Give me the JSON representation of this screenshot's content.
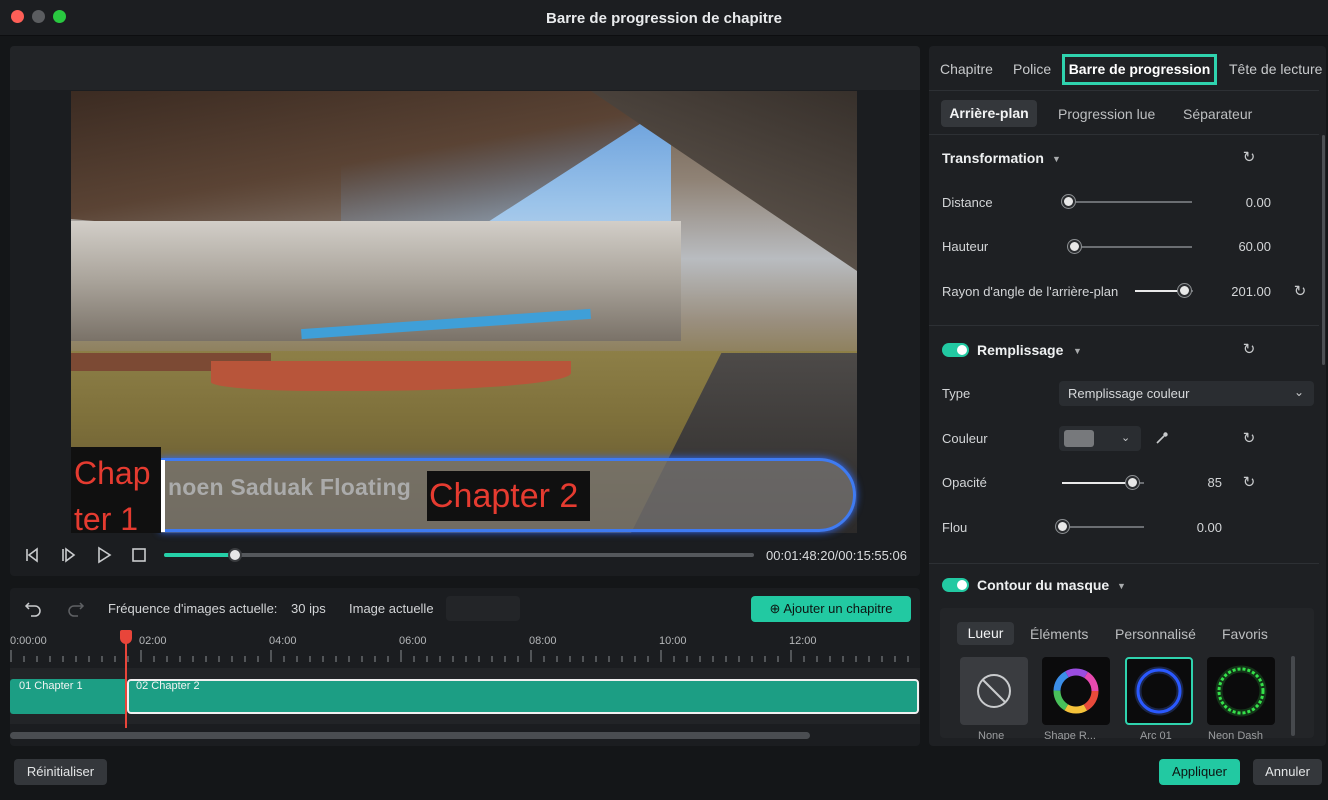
{
  "window": {
    "title": "Barre de progression de chapitre"
  },
  "preview": {
    "overlay_chapter1": "Chap ter 1",
    "overlay_floating_text": "noen Saduak Floating",
    "overlay_chapter2": "Chapter 2",
    "playback_progress": 0.12,
    "timecode": "00:01:48:20/00:15:55:06"
  },
  "timeline": {
    "frame_rate_label": "Fréquence d'images actuelle:",
    "frame_rate_value": "30 ips",
    "current_image_label": "Image actuelle",
    "add_chapter_label": "Ajouter un chapitre",
    "ruler_labels": [
      "0:00:00",
      "02:00",
      "04:00",
      "06:00",
      "08:00",
      "10:00",
      "12:00"
    ],
    "clips": [
      {
        "label": "01 Chapter 1"
      },
      {
        "label": "02 Chapter 2"
      }
    ]
  },
  "right_panel": {
    "tabs": [
      "Chapitre",
      "Police",
      "Barre de progression",
      "Tête de lecture"
    ],
    "active_tab": "Barre de progression",
    "subtabs": [
      "Arrière-plan",
      "Progression lue",
      "Séparateur"
    ],
    "active_subtab": "Arrière-plan",
    "transformation": {
      "title": "Transformation",
      "distance": {
        "label": "Distance",
        "value": "0.00",
        "level": 0.0
      },
      "height": {
        "label": "Hauteur",
        "value": "60.00",
        "level": 0.05
      },
      "corner_radius": {
        "label": "Rayon d'angle de l'arrière-plan",
        "value": "201.00",
        "level": 0.85
      }
    },
    "fill": {
      "title": "Remplissage",
      "enabled": true,
      "type_label": "Type",
      "type_value": "Remplissage couleur",
      "color_label": "Couleur",
      "color_value": "#77797c",
      "opacity": {
        "label": "Opacité",
        "value": "85",
        "level": 0.85
      },
      "blur": {
        "label": "Flou",
        "value": "0.00",
        "level": 0.0
      }
    },
    "mask_outline": {
      "title": "Contour du masque",
      "enabled": true,
      "style_tabs": [
        "Lueur",
        "Éléments",
        "Personnalisé",
        "Favoris"
      ],
      "active_style_tab": "Lueur",
      "presets": [
        {
          "label": "None",
          "icon": "none-circle-icon"
        },
        {
          "label": "Shape R...",
          "icon": "rainbow-ring-icon"
        },
        {
          "label": "Arc 01",
          "icon": "blue-ring-icon"
        },
        {
          "label": "Neon Dash",
          "icon": "green-dashed-ring-icon"
        }
      ]
    }
  },
  "footer": {
    "reset_label": "Réinitialiser",
    "apply_label": "Appliquer",
    "cancel_label": "Annuler"
  },
  "colors": {
    "accent": "#22c9a2",
    "highlight_border": "#2fd3ae",
    "chapter_text": "#e53b30",
    "progress_glow": "#3f7bf2"
  }
}
